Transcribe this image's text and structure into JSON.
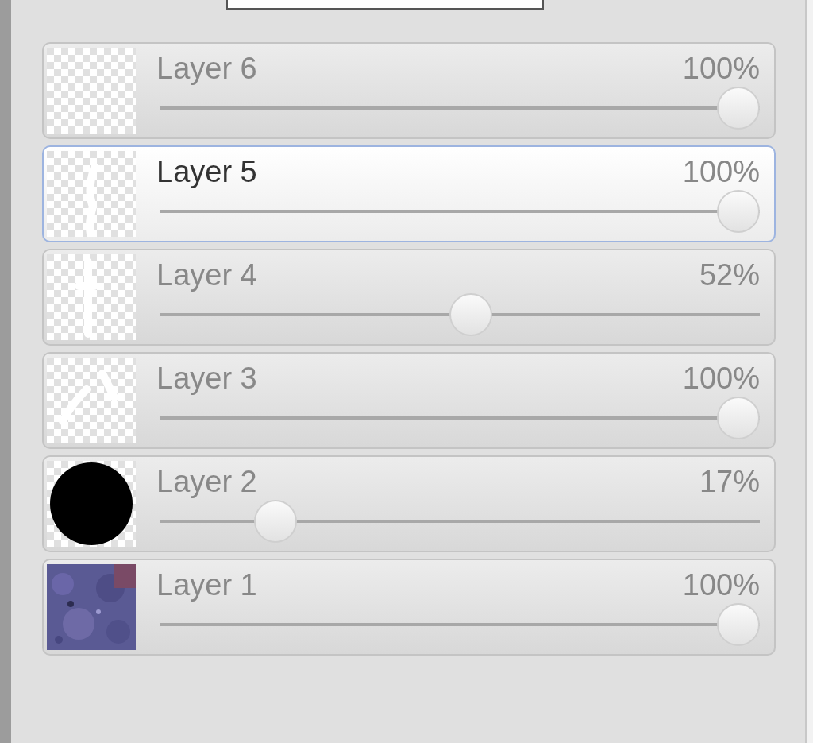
{
  "layers": [
    {
      "name": "Layer 6",
      "reading": "100%",
      "level": 1,
      "selected": false,
      "thumbnail": {
        "kind": "transparent"
      }
    },
    {
      "name": "Layer 5",
      "reading": "100%",
      "level": 1,
      "selected": true,
      "thumbnail": {
        "kind": "sketch"
      }
    },
    {
      "name": "Layer 4",
      "reading": "52%",
      "level": 0.52,
      "selected": false,
      "thumbnail": {
        "kind": "sketch"
      }
    },
    {
      "name": "Layer 3",
      "reading": "100%",
      "level": 1,
      "selected": false,
      "thumbnail": {
        "kind": "sketch"
      }
    },
    {
      "name": "Layer 2",
      "reading": "17%",
      "level": 0.17,
      "selected": false,
      "thumbnail": {
        "kind": "circle"
      }
    },
    {
      "name": "Layer 1",
      "reading": "100%",
      "level": 1,
      "selected": false
    }
  ]
}
